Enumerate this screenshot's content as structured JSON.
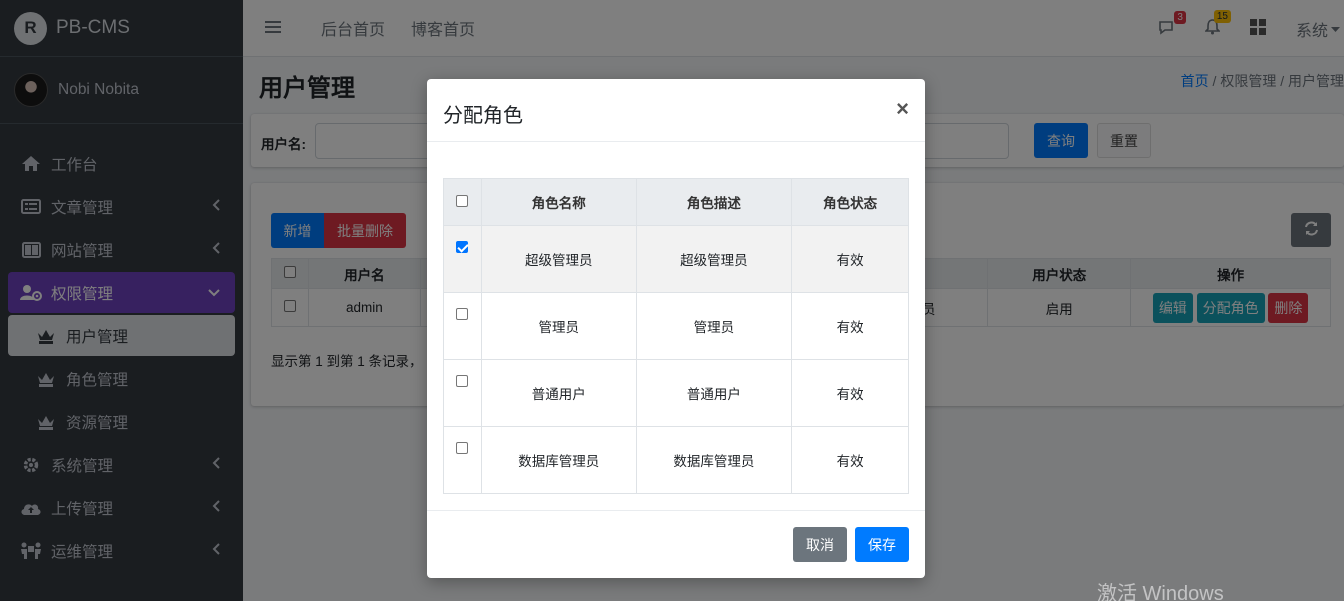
{
  "brand": {
    "logo": "R",
    "name": "PB-CMS"
  },
  "user": {
    "name": "Nobi Nobita"
  },
  "sidebar": {
    "items": [
      {
        "label": "工作台",
        "icon": "home-icon"
      },
      {
        "label": "文章管理",
        "icon": "list-icon"
      },
      {
        "label": "网站管理",
        "icon": "columns-icon"
      },
      {
        "label": "权限管理",
        "icon": "users-cog-icon"
      },
      {
        "label": "用户管理",
        "icon": "chess-queen-icon"
      },
      {
        "label": "角色管理",
        "icon": "chess-queen-icon"
      },
      {
        "label": "资源管理",
        "icon": "chess-queen-icon"
      },
      {
        "label": "系统管理",
        "icon": "cog-icon"
      },
      {
        "label": "上传管理",
        "icon": "cloud-upload-icon"
      },
      {
        "label": "运维管理",
        "icon": "people-carry-icon"
      }
    ],
    "accent": "#6f42c1"
  },
  "topbar": {
    "links": [
      "后台首页",
      "博客首页"
    ],
    "messages_count": "3",
    "notifications_count": "15",
    "system_label": "系统"
  },
  "page": {
    "title": "用户管理",
    "breadcrumb": {
      "home": "首页",
      "level1": "权限管理",
      "level2": "用户管理"
    },
    "search_label": "用户名:",
    "query_button": "查询",
    "reset_button": "重置",
    "add_button": "新增",
    "batch_delete_button": "批量删除",
    "table": {
      "headers": [
        "用户名",
        "用户状态",
        "操作"
      ],
      "rows": [
        {
          "username": "admin",
          "partial": "员",
          "status": "启用",
          "edit": "编辑",
          "assign": "分配角色",
          "delete": "删除"
        }
      ]
    },
    "pager_text": "显示第 1 到第 1 条记录，"
  },
  "modal": {
    "title": "分配角色",
    "close": "×",
    "headers": [
      "角色名称",
      "角色描述",
      "角色状态"
    ],
    "roles": [
      {
        "name": "超级管理员",
        "desc": "超级管理员",
        "status": "有效",
        "checked": true
      },
      {
        "name": "管理员",
        "desc": "管理员",
        "status": "有效",
        "checked": false
      },
      {
        "name": "普通用户",
        "desc": "普通用户",
        "status": "有效",
        "checked": false
      },
      {
        "name": "数据库管理员",
        "desc": "数据库管理员",
        "status": "有效",
        "checked": false
      }
    ],
    "cancel": "取消",
    "save": "保存"
  },
  "watermark": "激活 Windows"
}
